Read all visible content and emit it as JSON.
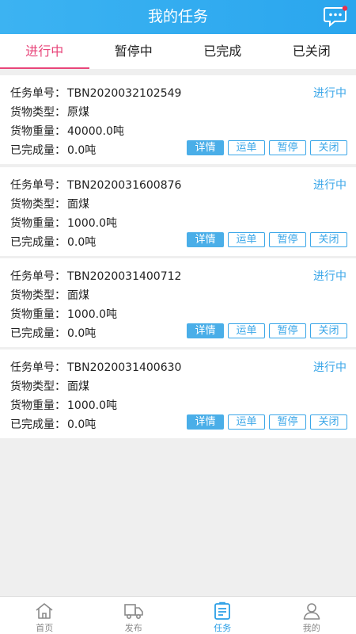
{
  "header": {
    "title": "我的任务",
    "message_icon": "message-dots-icon"
  },
  "tabs": [
    {
      "label": "进行中"
    },
    {
      "label": "暂停中"
    },
    {
      "label": "已完成"
    },
    {
      "label": "已关闭"
    }
  ],
  "labels": {
    "task_no": "任务单号：",
    "cargo_type": "货物类型：",
    "cargo_weight": "货物重量：",
    "completed": "已完成量："
  },
  "tasks": [
    {
      "task_no": "TBN2020032102549",
      "cargo_type": "原煤",
      "cargo_weight": "40000.0吨",
      "completed": "0.0吨",
      "status": "进行中"
    },
    {
      "task_no": "TBN2020031600876",
      "cargo_type": "面煤",
      "cargo_weight": "1000.0吨",
      "completed": "0.0吨",
      "status": "进行中"
    },
    {
      "task_no": "TBN2020031400712",
      "cargo_type": "面煤",
      "cargo_weight": "1000.0吨",
      "completed": "0.0吨",
      "status": "进行中"
    },
    {
      "task_no": "TBN2020031400630",
      "cargo_type": "面煤",
      "cargo_weight": "1000.0吨",
      "completed": "0.0吨",
      "status": "进行中"
    }
  ],
  "actions": {
    "detail": "详情",
    "waybill": "运单",
    "pause": "暂停",
    "close": "关闭"
  },
  "bottom_nav": [
    {
      "label": "首页",
      "icon": "home-icon"
    },
    {
      "label": "发布",
      "icon": "truck-icon"
    },
    {
      "label": "任务",
      "icon": "task-list-icon"
    },
    {
      "label": "我的",
      "icon": "user-icon"
    }
  ],
  "colors": {
    "header": "#2aa6ee",
    "tab_active": "#e8457a",
    "accent": "#3aa6e8",
    "background": "#efefef"
  }
}
